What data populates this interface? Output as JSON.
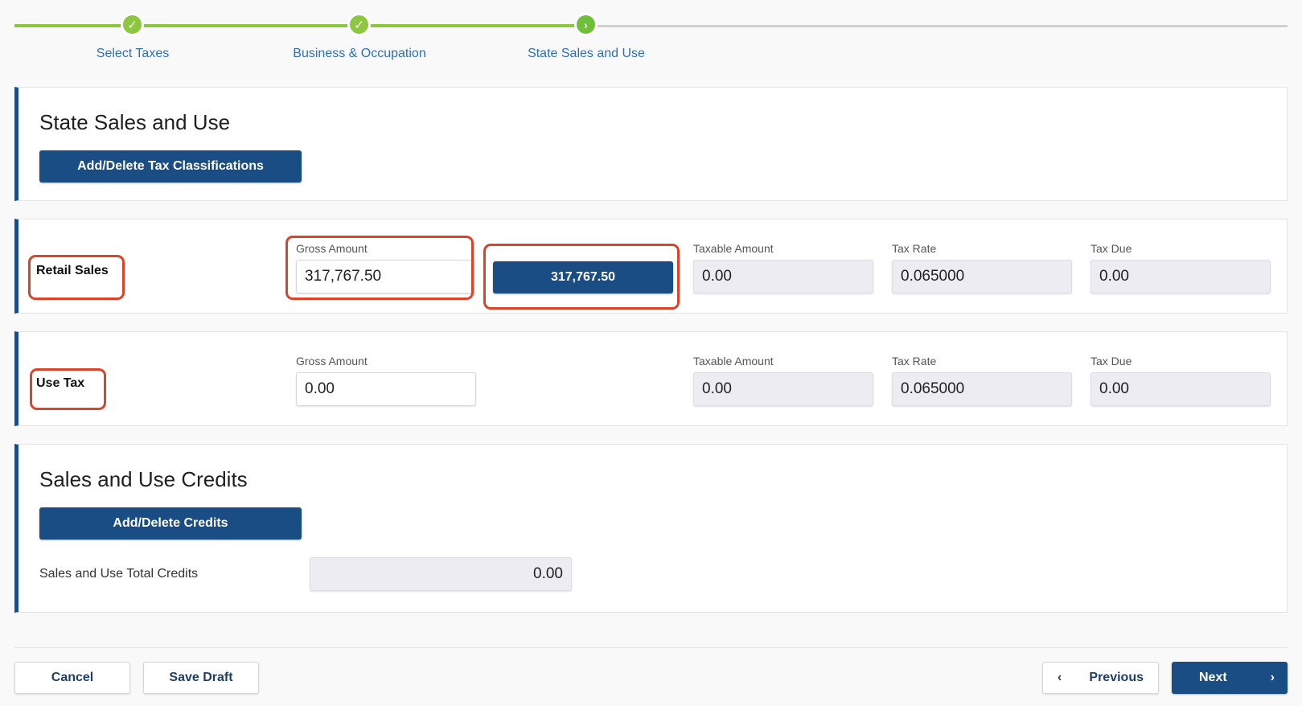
{
  "stepper": {
    "steps": [
      {
        "label": "Select Taxes",
        "status": "complete",
        "icon": "check-icon"
      },
      {
        "label": "Business & Occupation",
        "status": "complete",
        "icon": "check-icon"
      },
      {
        "label": "State Sales and Use",
        "status": "current",
        "icon": "chevron-right-icon"
      }
    ],
    "check_glyph": "✓",
    "current_glyph": "›"
  },
  "state_sales": {
    "title": "State Sales and Use",
    "add_delete_button": "Add/Delete Tax Classifications"
  },
  "retail_sales": {
    "label": "Retail Sales",
    "gross_amount_label": "Gross Amount",
    "gross_amount_value": "317,767.50",
    "deduction_button": "317,767.50",
    "taxable_amount_label": "Taxable Amount",
    "taxable_amount_value": "0.00",
    "tax_rate_label": "Tax Rate",
    "tax_rate_value": "0.065000",
    "tax_due_label": "Tax Due",
    "tax_due_value": "0.00"
  },
  "use_tax": {
    "label": "Use Tax",
    "gross_amount_label": "Gross Amount",
    "gross_amount_value": "0.00",
    "taxable_amount_label": "Taxable Amount",
    "taxable_amount_value": "0.00",
    "tax_rate_label": "Tax Rate",
    "tax_rate_value": "0.065000",
    "tax_due_label": "Tax Due",
    "tax_due_value": "0.00"
  },
  "credits": {
    "title": "Sales and Use Credits",
    "add_delete_button": "Add/Delete Credits",
    "total_credits_label": "Sales and Use Total Credits",
    "total_credits_value": "0.00"
  },
  "footer": {
    "cancel": "Cancel",
    "save_draft": "Save Draft",
    "previous": "Previous",
    "next": "Next",
    "prev_glyph": "‹",
    "next_glyph": "›"
  },
  "colors": {
    "primary": "#1a4d84",
    "step_complete": "#8dc63f",
    "highlight": "#d9442b",
    "link": "#2d6fb5"
  }
}
